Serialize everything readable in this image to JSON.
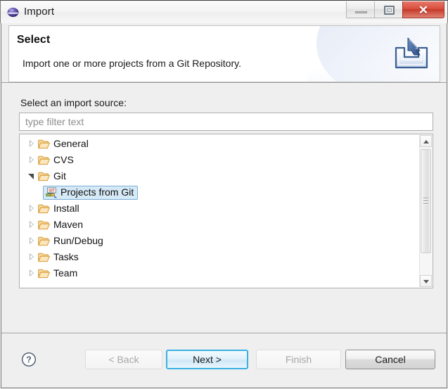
{
  "window": {
    "title": "Import",
    "app_icon": "eclipse-sphere-icon",
    "controls": {
      "minimize": "minimize-icon",
      "maximize": "restore-icon",
      "close": "✕"
    }
  },
  "header": {
    "title": "Select",
    "description": "Import one or more projects from a Git Repository.",
    "icon": "import-wizard-icon"
  },
  "content": {
    "source_label": "Select an import source:",
    "filter": {
      "value": "",
      "placeholder": "type filter text"
    },
    "tree": [
      {
        "label": "General",
        "icon": "folder-icon",
        "state": "collapsed",
        "level": 0,
        "selected": false
      },
      {
        "label": "CVS",
        "icon": "folder-icon",
        "state": "collapsed",
        "level": 0,
        "selected": false
      },
      {
        "label": "Git",
        "icon": "folder-icon",
        "state": "expanded",
        "level": 0,
        "selected": false
      },
      {
        "label": "Projects from Git",
        "icon": "git-repository-icon",
        "state": "leaf",
        "level": 1,
        "selected": true
      },
      {
        "label": "Install",
        "icon": "folder-icon",
        "state": "collapsed",
        "level": 0,
        "selected": false
      },
      {
        "label": "Maven",
        "icon": "folder-icon",
        "state": "collapsed",
        "level": 0,
        "selected": false
      },
      {
        "label": "Run/Debug",
        "icon": "folder-icon",
        "state": "collapsed",
        "level": 0,
        "selected": false
      },
      {
        "label": "Tasks",
        "icon": "folder-icon",
        "state": "collapsed",
        "level": 0,
        "selected": false
      },
      {
        "label": "Team",
        "icon": "folder-icon",
        "state": "collapsed",
        "level": 0,
        "selected": false
      }
    ],
    "scrollbar": {
      "orientation": "vertical",
      "up_arrow": "scroll-up-icon",
      "down_arrow": "scroll-down-icon"
    }
  },
  "footer": {
    "help": "?",
    "buttons": [
      {
        "label": "< Back",
        "enabled": false,
        "default": false
      },
      {
        "label": "Next >",
        "enabled": true,
        "default": true
      },
      {
        "label": "Finish",
        "enabled": false,
        "default": false
      },
      {
        "label": "Cancel",
        "enabled": true,
        "default": false
      }
    ]
  },
  "colors": {
    "accent": "#3ab0e2",
    "selection_bg": "#d5e9f7",
    "selection_border": "#7aaed6",
    "close_red": "#c63a29",
    "folder": "#f0b75a",
    "dialog_bg": "#efefef"
  }
}
